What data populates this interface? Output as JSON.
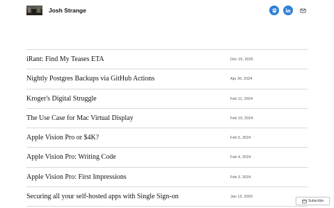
{
  "header": {
    "site_title": "Josh Strange",
    "logo_icon": "site-logo-image",
    "social_icons": [
      "mastodon-icon",
      "linkedin-icon",
      "mail-icon"
    ],
    "accent_color": "#2f7fd6"
  },
  "posts": [
    {
      "title": "iRant: Find My Teases ETA",
      "date": "Dec 16, 2025"
    },
    {
      "title": "Nightly Postgres Backups via GitHub Actions",
      "date": "Apr 26, 2024"
    },
    {
      "title": "Kroger's Digital Struggle",
      "date": "Feb 11, 2024"
    },
    {
      "title": "The Use Case for Mac Virtual Display",
      "date": "Feb 10, 2024"
    },
    {
      "title": "Apple Vision Pro or $4K?",
      "date": "Feb 5, 2024"
    },
    {
      "title": "Apple Vision Pro: Writing Code",
      "date": "Feb 4, 2024"
    },
    {
      "title": "Apple Vision Pro: First Impressions",
      "date": "Feb 3, 2024"
    },
    {
      "title": "Securing all your self-hosted apps with Single Sign-on",
      "date": "Jan 13, 2020"
    }
  ],
  "subscribe": {
    "label": "Subscribe",
    "icon": "reader-icon"
  }
}
